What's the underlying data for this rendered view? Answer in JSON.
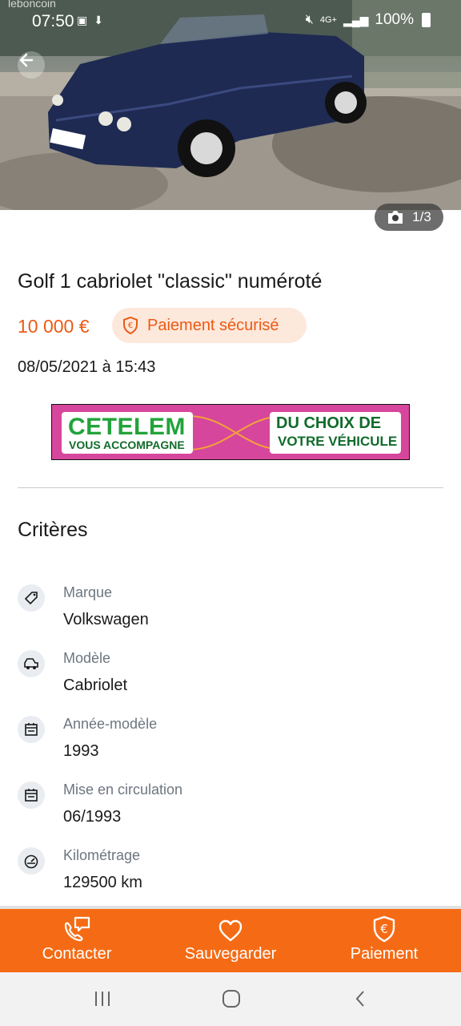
{
  "status_bar": {
    "brand": "leboncoin",
    "time": "07:50",
    "network": "4G+",
    "battery": "100%"
  },
  "gallery": {
    "counter": "1/3"
  },
  "listing": {
    "title": "Golf 1 cabriolet \"classic\" numéroté",
    "price": "10 000 €",
    "payment_badge": "Paiement sécurisé",
    "date": "08/05/2021 à 15:43"
  },
  "ad": {
    "left_big": "CETELEM",
    "left_small": "VOUS ACCOMPAGNE",
    "right_line1": "DU CHOIX DE",
    "right_line2": "VOTRE VÉHICULE"
  },
  "criteria": {
    "title": "Critères",
    "items": [
      {
        "label": "Marque",
        "value": "Volkswagen",
        "icon": "tag-icon"
      },
      {
        "label": "Modèle",
        "value": "Cabriolet",
        "icon": "car-icon"
      },
      {
        "label": "Année-modèle",
        "value": "1993",
        "icon": "calendar-icon"
      },
      {
        "label": "Mise en circulation",
        "value": "06/1993",
        "icon": "calendar-icon"
      },
      {
        "label": "Kilométrage",
        "value": "129500 km",
        "icon": "speedometer-icon"
      }
    ]
  },
  "actions": {
    "contact": "Contacter",
    "save": "Sauvegarder",
    "payment": "Paiement"
  },
  "colors": {
    "accent": "#f56b15",
    "price": "#ec5a13",
    "badge_bg": "#fde8dc",
    "label_gray": "#6d7680"
  }
}
